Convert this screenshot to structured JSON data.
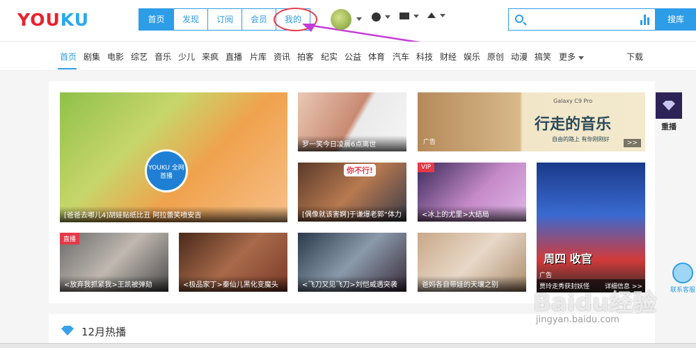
{
  "logo": {
    "part_red": "YOU",
    "part_blue": "KU"
  },
  "main_nav": [
    {
      "label": "首页"
    },
    {
      "label": "发现"
    },
    {
      "label": "订阅"
    },
    {
      "label": "会员"
    },
    {
      "label": "我的"
    }
  ],
  "header_icons": {
    "history": "clock-icon",
    "messages": "envelope-icon",
    "upload": "upload-icon"
  },
  "search": {
    "placeholder": "",
    "button": "搜库"
  },
  "sub_nav": {
    "items": [
      "首页",
      "剧集",
      "电影",
      "综艺",
      "音乐",
      "少儿",
      "来疯",
      "直播",
      "片库",
      "资讯",
      "拍客",
      "纪实",
      "公益",
      "体育",
      "汽车",
      "科技",
      "财经",
      "娱乐",
      "原创",
      "动漫",
      "搞笑",
      "更多"
    ],
    "download": "下载"
  },
  "tiles": [
    {
      "caption": "[爸爸去哪儿4]胡娃贴纸比丑 阿拉蕾笑喷安吉",
      "badge_text": "YOUKU 全网首播"
    },
    {
      "caption": "罗一笑今日凌晨6点离世"
    },
    {
      "ad_label": "广告",
      "ad_headline": "行走的音乐",
      "ad_brand": "Galaxy C9 Pro",
      "ad_sub": "自由的路上 有你刚刚好",
      "more": ">>"
    },
    {
      "caption": "[偶像就该害婀]于谦爆老郭“体力",
      "bubble": "你不行!"
    },
    {
      "caption": "<冰上的尤里>大结局",
      "tag": "VIP"
    },
    {
      "caption": "贾玲走秀获封妖怪",
      "ad_label": "广告",
      "banner": "周四 收官",
      "more": "详细信息 >>"
    },
    {
      "caption": "<放弃我抓紧我>王凯被弹劾",
      "tag": "直播"
    },
    {
      "caption": "<极品家丁>秦仙儿黑化变魔头"
    },
    {
      "caption": "<飞刀又见飞刀>刘恺威遇突袭"
    },
    {
      "caption": "爸妈各自带娃的天壤之别"
    }
  ],
  "side": {
    "replay": "重播",
    "service": "联系客服"
  },
  "section": {
    "title": "12月热播"
  },
  "watermark": {
    "main": "Baidu经验",
    "sub": "jingyan.baidu.com"
  }
}
